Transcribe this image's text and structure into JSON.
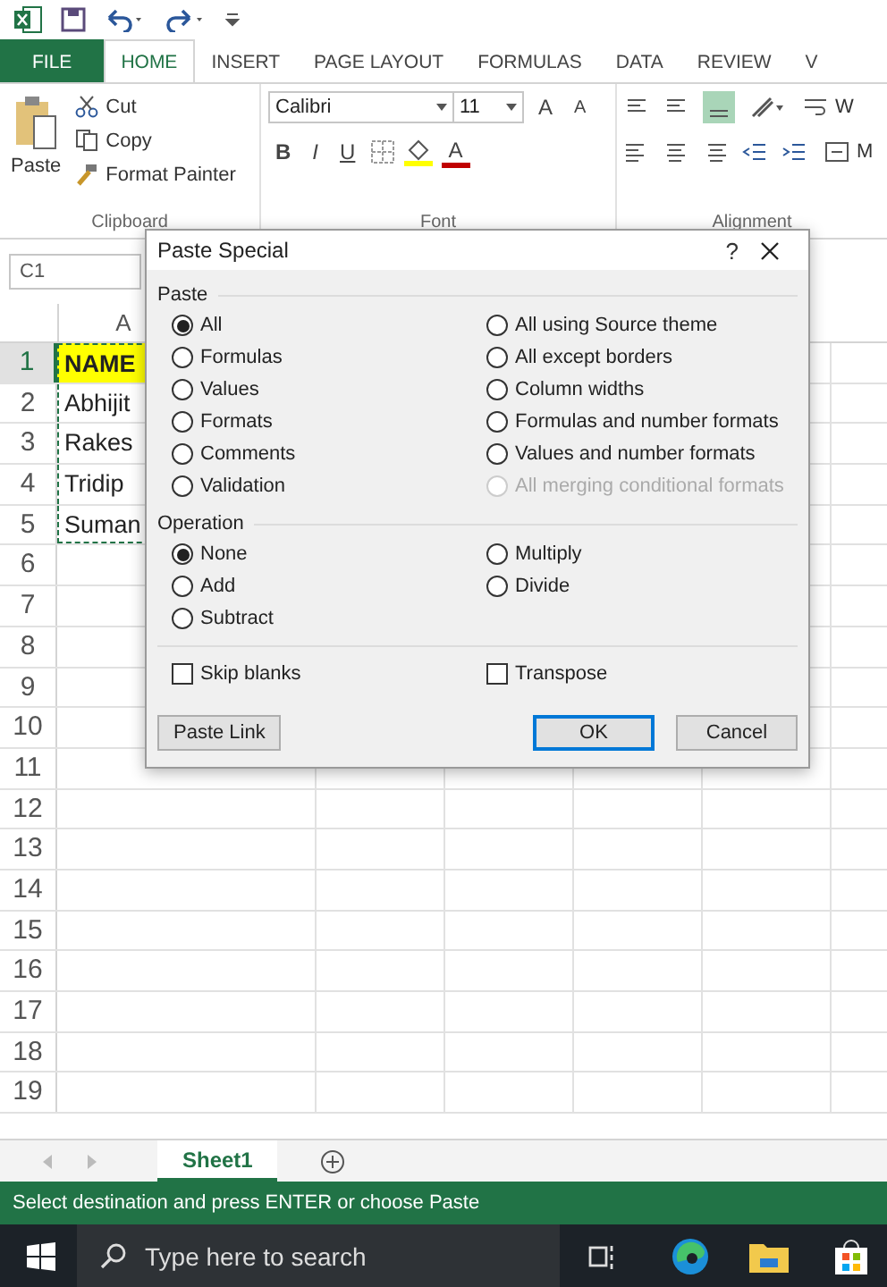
{
  "ribbon_tabs": [
    {
      "label": "FILE",
      "kind": "file",
      "selected": false
    },
    {
      "label": "HOME",
      "kind": "tab",
      "selected": true
    },
    {
      "label": "INSERT",
      "kind": "tab",
      "selected": false
    },
    {
      "label": "PAGE LAYOUT",
      "kind": "tab",
      "selected": false
    },
    {
      "label": "FORMULAS",
      "kind": "tab",
      "selected": false
    },
    {
      "label": "DATA",
      "kind": "tab",
      "selected": false
    },
    {
      "label": "REVIEW",
      "kind": "tab",
      "selected": false
    },
    {
      "label": "V",
      "kind": "tab",
      "selected": false
    }
  ],
  "clipboard": {
    "paste": "Paste",
    "cut": "Cut",
    "copy": "Copy",
    "format_painter": "Format Painter",
    "group": "Clipboard"
  },
  "font": {
    "name": "Calibri",
    "size": "11",
    "grow": "A",
    "shrink": "A",
    "bold": "B",
    "italic": "I",
    "underline": "U",
    "font_color": "A",
    "group": "Font"
  },
  "alignment": {
    "wrap": "W",
    "merge": "M",
    "group": "Alignment"
  },
  "name_box": "C1",
  "sheet": {
    "columns": [
      "A"
    ],
    "rows": [
      {
        "number": "1",
        "cell": "NAME",
        "highlighted": true
      },
      {
        "number": "2",
        "cell": "Abhijit",
        "highlighted": false
      },
      {
        "number": "3",
        "cell": "Rakes",
        "highlighted": false
      },
      {
        "number": "4",
        "cell": "Tridip",
        "highlighted": false
      },
      {
        "number": "5",
        "cell": "Suman",
        "highlighted": false
      },
      {
        "number": "6"
      },
      {
        "number": "7"
      },
      {
        "number": "8"
      },
      {
        "number": "9"
      },
      {
        "number": "10"
      },
      {
        "number": "11"
      },
      {
        "number": "12"
      },
      {
        "number": "13"
      },
      {
        "number": "14"
      },
      {
        "number": "15"
      },
      {
        "number": "16"
      },
      {
        "number": "17"
      },
      {
        "number": "18"
      },
      {
        "number": "19"
      }
    ]
  },
  "dialog": {
    "title": "Paste Special",
    "help": "?",
    "paste": {
      "label": "Paste",
      "columns": [
        [
          {
            "label": "All",
            "selected": true,
            "disabled": false
          },
          {
            "label": "Formulas",
            "selected": false,
            "disabled": false
          },
          {
            "label": "Values",
            "selected": false,
            "disabled": false
          },
          {
            "label": "Formats",
            "selected": false,
            "disabled": false
          },
          {
            "label": "Comments",
            "selected": false,
            "disabled": false
          },
          {
            "label": "Validation",
            "selected": false,
            "disabled": false
          }
        ],
        [
          {
            "label": "All using Source theme",
            "selected": false,
            "disabled": false
          },
          {
            "label": "All except borders",
            "selected": false,
            "disabled": false
          },
          {
            "label": "Column widths",
            "selected": false,
            "disabled": false
          },
          {
            "label": "Formulas and number formats",
            "selected": false,
            "disabled": false
          },
          {
            "label": "Values and number formats",
            "selected": false,
            "disabled": false
          },
          {
            "label": "All merging conditional formats",
            "selected": false,
            "disabled": true
          }
        ]
      ]
    },
    "operation": {
      "label": "Operation",
      "columns": [
        [
          {
            "label": "None",
            "selected": true,
            "disabled": false
          },
          {
            "label": "Add",
            "selected": false,
            "disabled": false
          },
          {
            "label": "Subtract",
            "selected": false,
            "disabled": false
          }
        ],
        [
          {
            "label": "Multiply",
            "selected": false,
            "disabled": false
          },
          {
            "label": "Divide",
            "selected": false,
            "disabled": false
          }
        ]
      ]
    },
    "checkboxes": [
      {
        "label": "Skip blanks",
        "checked": false
      },
      {
        "label": "Transpose",
        "checked": false
      }
    ],
    "buttons": [
      {
        "label": "Paste Link",
        "default": false
      },
      {
        "label": "OK",
        "default": true
      },
      {
        "label": "Cancel",
        "default": false
      }
    ]
  },
  "sheet_tabs": [
    {
      "label": "Sheet1",
      "selected": true
    }
  ],
  "status_bar": "Select destination and press ENTER or choose Paste",
  "taskbar": {
    "search_placeholder": "Type here to search"
  }
}
